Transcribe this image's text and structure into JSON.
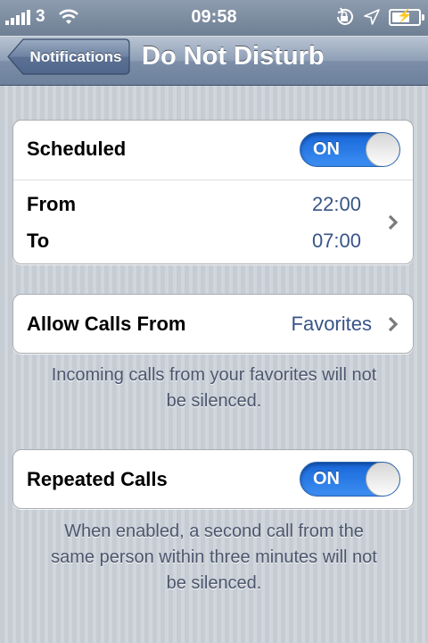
{
  "status_bar": {
    "carrier": "3",
    "time": "09:58"
  },
  "nav": {
    "back_label": "Notifications",
    "title": "Do Not Disturb"
  },
  "scheduled": {
    "label": "Scheduled",
    "toggle": "ON",
    "from_label": "From",
    "from_value": "22:00",
    "to_label": "To",
    "to_value": "07:00"
  },
  "allow_calls": {
    "label": "Allow Calls From",
    "value": "Favorites",
    "footnote_line1": "Incoming calls from your favorites will not",
    "footnote_line2": "be silenced."
  },
  "repeated_calls": {
    "label": "Repeated Calls",
    "toggle": "ON",
    "footnote_line1": "When enabled, a second call from the",
    "footnote_line2": "same person within three minutes will not",
    "footnote_line3": "be silenced."
  },
  "colors": {
    "accent_blue": "#3b8df2",
    "value_text": "#385487",
    "nav_bar": "#7c8ea8"
  },
  "icons": [
    "signal-bars-icon",
    "wifi-icon",
    "rotation-lock-icon",
    "location-arrow-icon",
    "battery-charging-icon",
    "chevron-right-icon"
  ]
}
